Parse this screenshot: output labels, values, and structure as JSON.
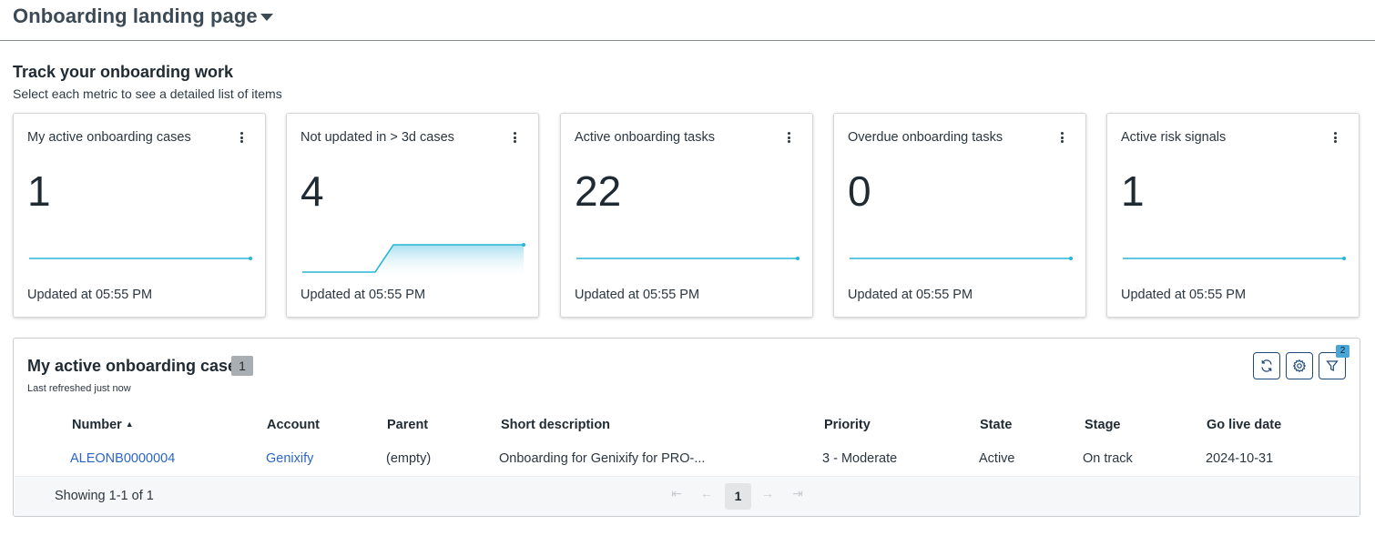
{
  "header": {
    "title": "Onboarding landing page"
  },
  "section": {
    "title": "Track your onboarding work",
    "subtitle": "Select each metric to see a detailed list of items"
  },
  "cards": [
    {
      "title": "My active onboarding cases",
      "value": "1",
      "updated": "Updated at 05:55 PM",
      "trend": "flat"
    },
    {
      "title": "Not updated in > 3d cases",
      "value": "4",
      "updated": "Updated at 05:55 PM",
      "trend": "step-up"
    },
    {
      "title": "Active onboarding tasks",
      "value": "22",
      "updated": "Updated at 05:55 PM",
      "trend": "flat"
    },
    {
      "title": "Overdue onboarding tasks",
      "value": "0",
      "updated": "Updated at 05:55 PM",
      "trend": "flat"
    },
    {
      "title": "Active risk signals",
      "value": "1",
      "updated": "Updated at 05:55 PM",
      "trend": "flat"
    }
  ],
  "list": {
    "title": "My active onboarding cases",
    "count": "1",
    "refreshed": "Last refreshed just now",
    "filter_count": "2",
    "columns": [
      "Number",
      "Account",
      "Parent",
      "Short description",
      "Priority",
      "State",
      "Stage",
      "Go live date"
    ],
    "rows": [
      [
        "ALEONB0000004",
        "Genixify",
        "(empty)",
        "Onboarding for Genixify for PRO-...",
        "3 - Moderate",
        "Active",
        "On track",
        "2024-10-31"
      ]
    ],
    "showing": "Showing 1-1 of 1",
    "page": "1"
  },
  "colors": {
    "accent_line": "#29b6d6",
    "link": "#2b65c8",
    "button_border": "#1e4a7a",
    "filter_badge": "#4aa6d9"
  }
}
